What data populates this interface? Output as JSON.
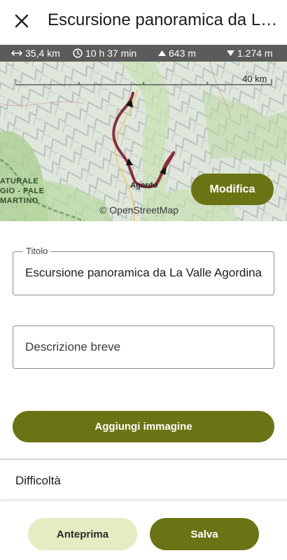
{
  "header": {
    "title": "Escursione panoramica da La Valle Agordina"
  },
  "stats": {
    "distance": "35,4 km",
    "duration": "10 h 37 min",
    "ascent": "643 m",
    "descent": "1.274 m"
  },
  "map": {
    "scale_label": "40 km",
    "attribution": "© OpenStreetMap",
    "town_label": "Agordo",
    "region_label_lines": [
      "ATURALE",
      "GIO - PALE",
      "MARTINO"
    ],
    "edit_label": "Modifica"
  },
  "form": {
    "title_legend": "Titolo",
    "title_value": "Escursione panoramica da La Valle Agordina",
    "description_placeholder": "Descrizione breve",
    "add_image_label": "Aggiungi immagine",
    "difficulty_label": "Difficoltà"
  },
  "actions": {
    "preview_label": "Anteprima",
    "save_label": "Salva"
  },
  "colors": {
    "accent": "#6b7414",
    "accent_light": "#e6ebc1",
    "route": "#8b2d3c",
    "stats_bg": "#5b5b5b"
  },
  "icons": {
    "close": "close-icon",
    "distance": "arrows-horizontal-icon",
    "duration": "clock-icon",
    "ascent": "triangle-up-icon",
    "descent": "triangle-down-icon"
  }
}
